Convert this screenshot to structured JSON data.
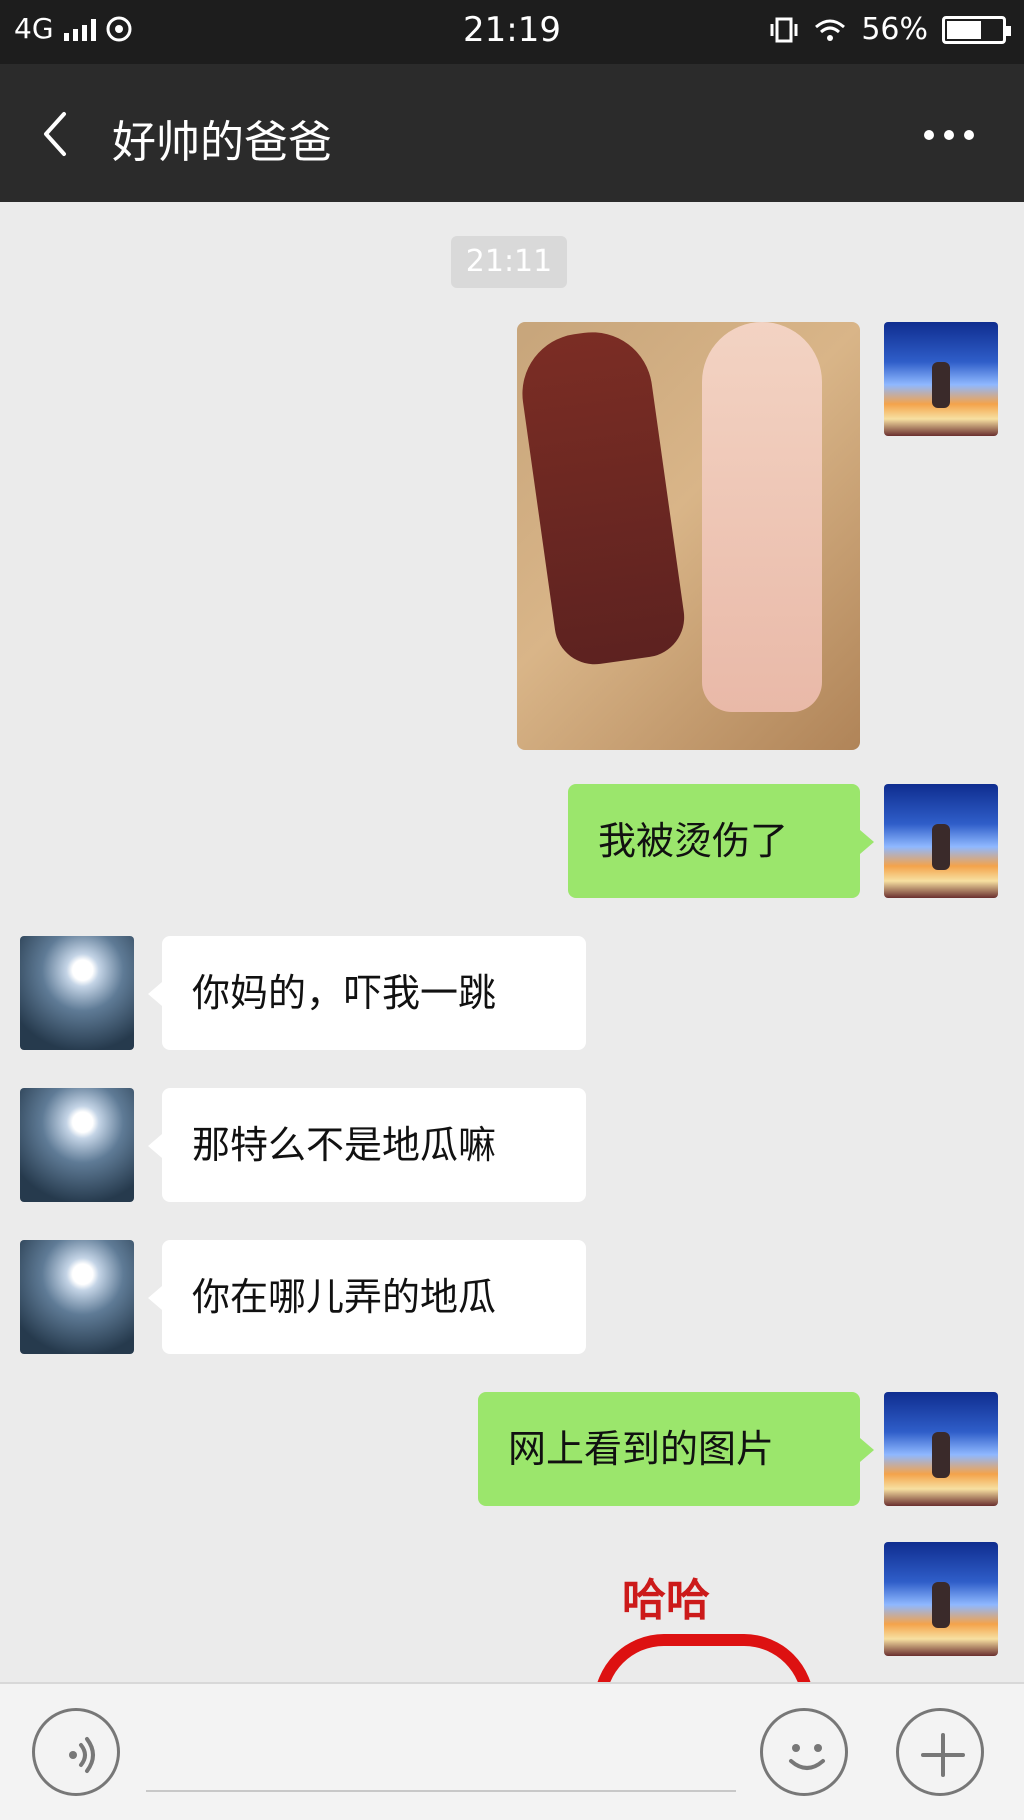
{
  "statusbar": {
    "network": "4G",
    "time": "21:19",
    "battery": "56%"
  },
  "navbar": {
    "title": "好帅的爸爸"
  },
  "chat": {
    "timestamp": "21:11",
    "messages": [
      {
        "side": "right",
        "type": "image"
      },
      {
        "side": "right",
        "type": "text",
        "text": "我被烫伤了"
      },
      {
        "side": "left",
        "type": "text",
        "text": "你妈的，吓我一跳"
      },
      {
        "side": "left",
        "type": "text",
        "text": "那特么不是地瓜嘛"
      },
      {
        "side": "left",
        "type": "text",
        "text": "你在哪儿弄的地瓜"
      },
      {
        "side": "right",
        "type": "text",
        "text": "网上看到的图片"
      },
      {
        "side": "right",
        "type": "sticker",
        "text": "哈哈"
      }
    ]
  },
  "inputbar": {
    "icons": [
      "voice-icon",
      "emoji-icon",
      "plus-icon"
    ]
  },
  "colors": {
    "green_bubble": "#9be66c",
    "white_bubble": "#ffffff",
    "bg": "#ebebeb",
    "topbar": "#2b2b2b"
  }
}
